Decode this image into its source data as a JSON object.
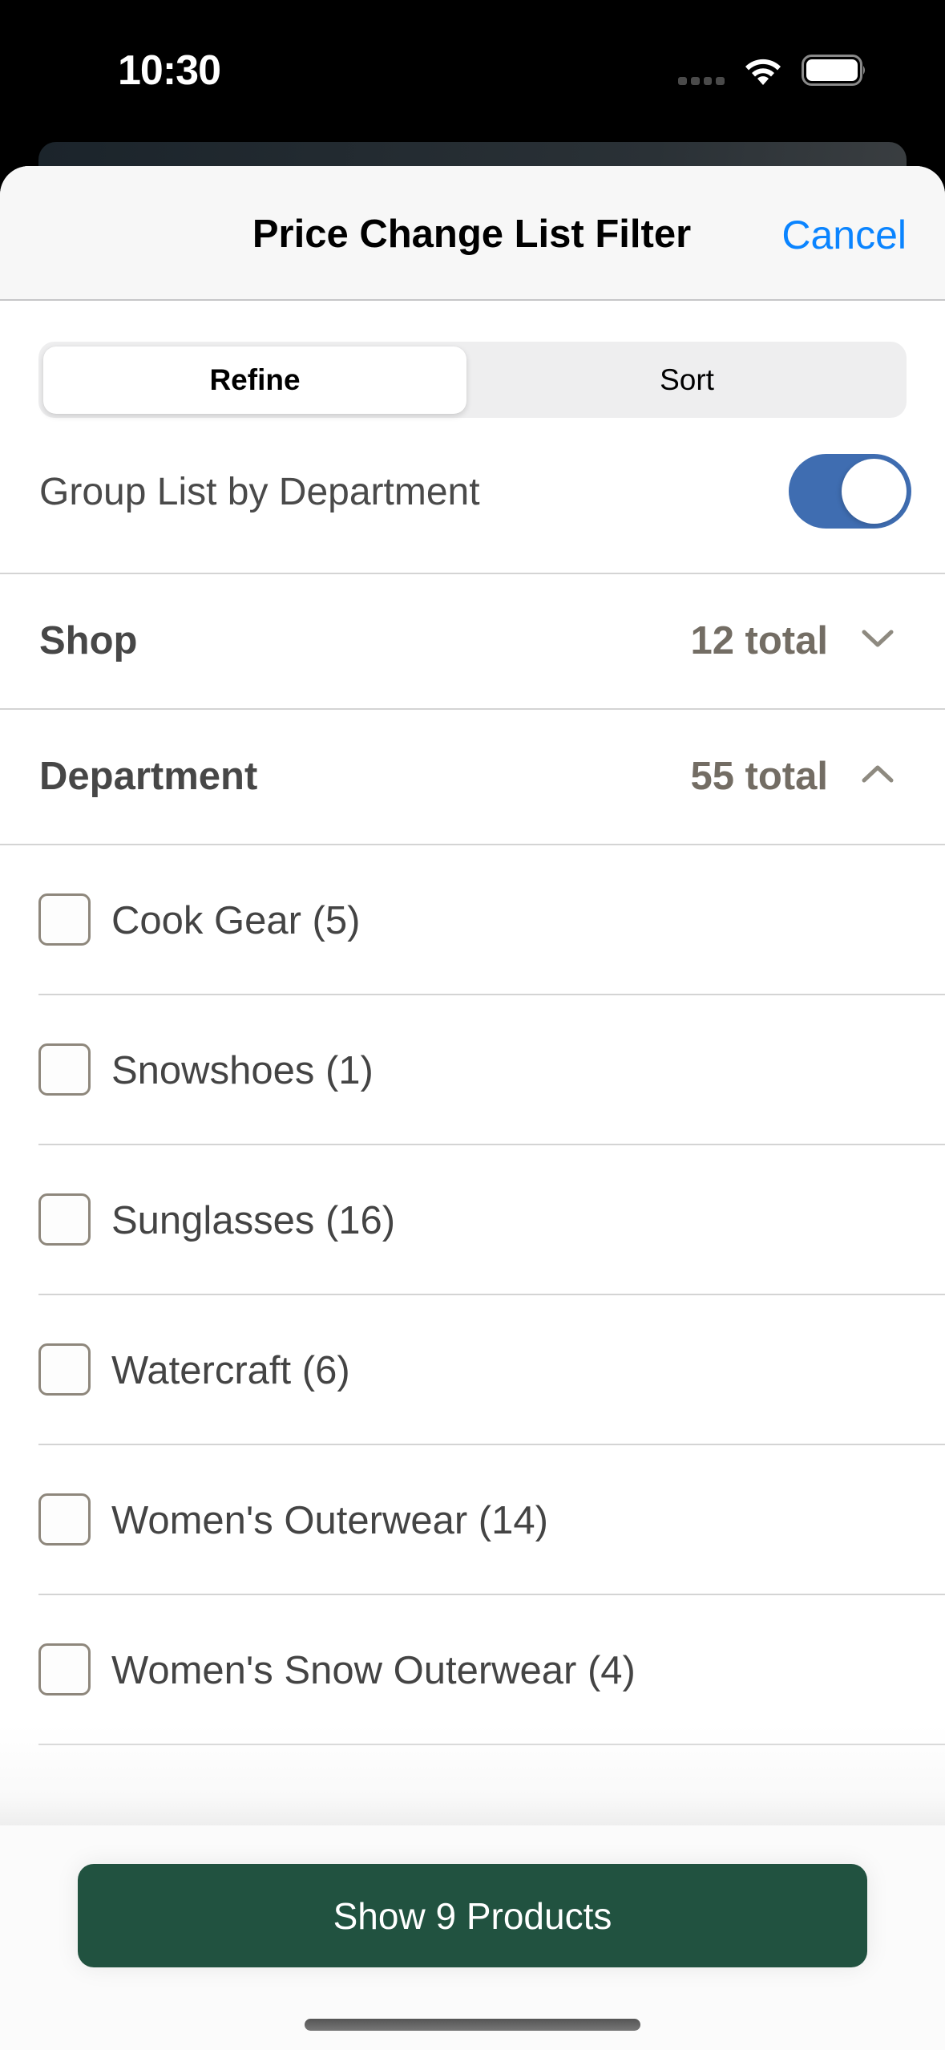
{
  "status_bar": {
    "time": "10:30",
    "icons": [
      "signal-dots-icon",
      "wifi-icon",
      "battery-icon"
    ]
  },
  "nav": {
    "title": "Price Change List Filter",
    "cancel_label": "Cancel",
    "accent_color": "#0a84ff"
  },
  "segmented": {
    "options": [
      {
        "label": "Refine",
        "selected": true
      },
      {
        "label": "Sort",
        "selected": false
      }
    ]
  },
  "group_by_department": {
    "label": "Group List by Department",
    "enabled": true,
    "toggle_color": "#3f6db1"
  },
  "filters": {
    "shop": {
      "title": "Shop",
      "total": "12 total",
      "expanded": false,
      "chevron": "chevron-down-icon"
    },
    "department": {
      "title": "Department",
      "total": "55 total",
      "expanded": true,
      "chevron": "chevron-up-icon"
    }
  },
  "departments": [
    {
      "label": "Cook Gear (5)",
      "checked": false
    },
    {
      "label": "Snowshoes (1)",
      "checked": false
    },
    {
      "label": "Sunglasses (16)",
      "checked": false
    },
    {
      "label": "Watercraft (6)",
      "checked": false
    },
    {
      "label": "Women's Outerwear (14)",
      "checked": false
    },
    {
      "label": "Women's Snow Outerwear (4)",
      "checked": false
    }
  ],
  "footer": {
    "primary_label": "Show 9 Products",
    "primary_color": "#215240"
  }
}
